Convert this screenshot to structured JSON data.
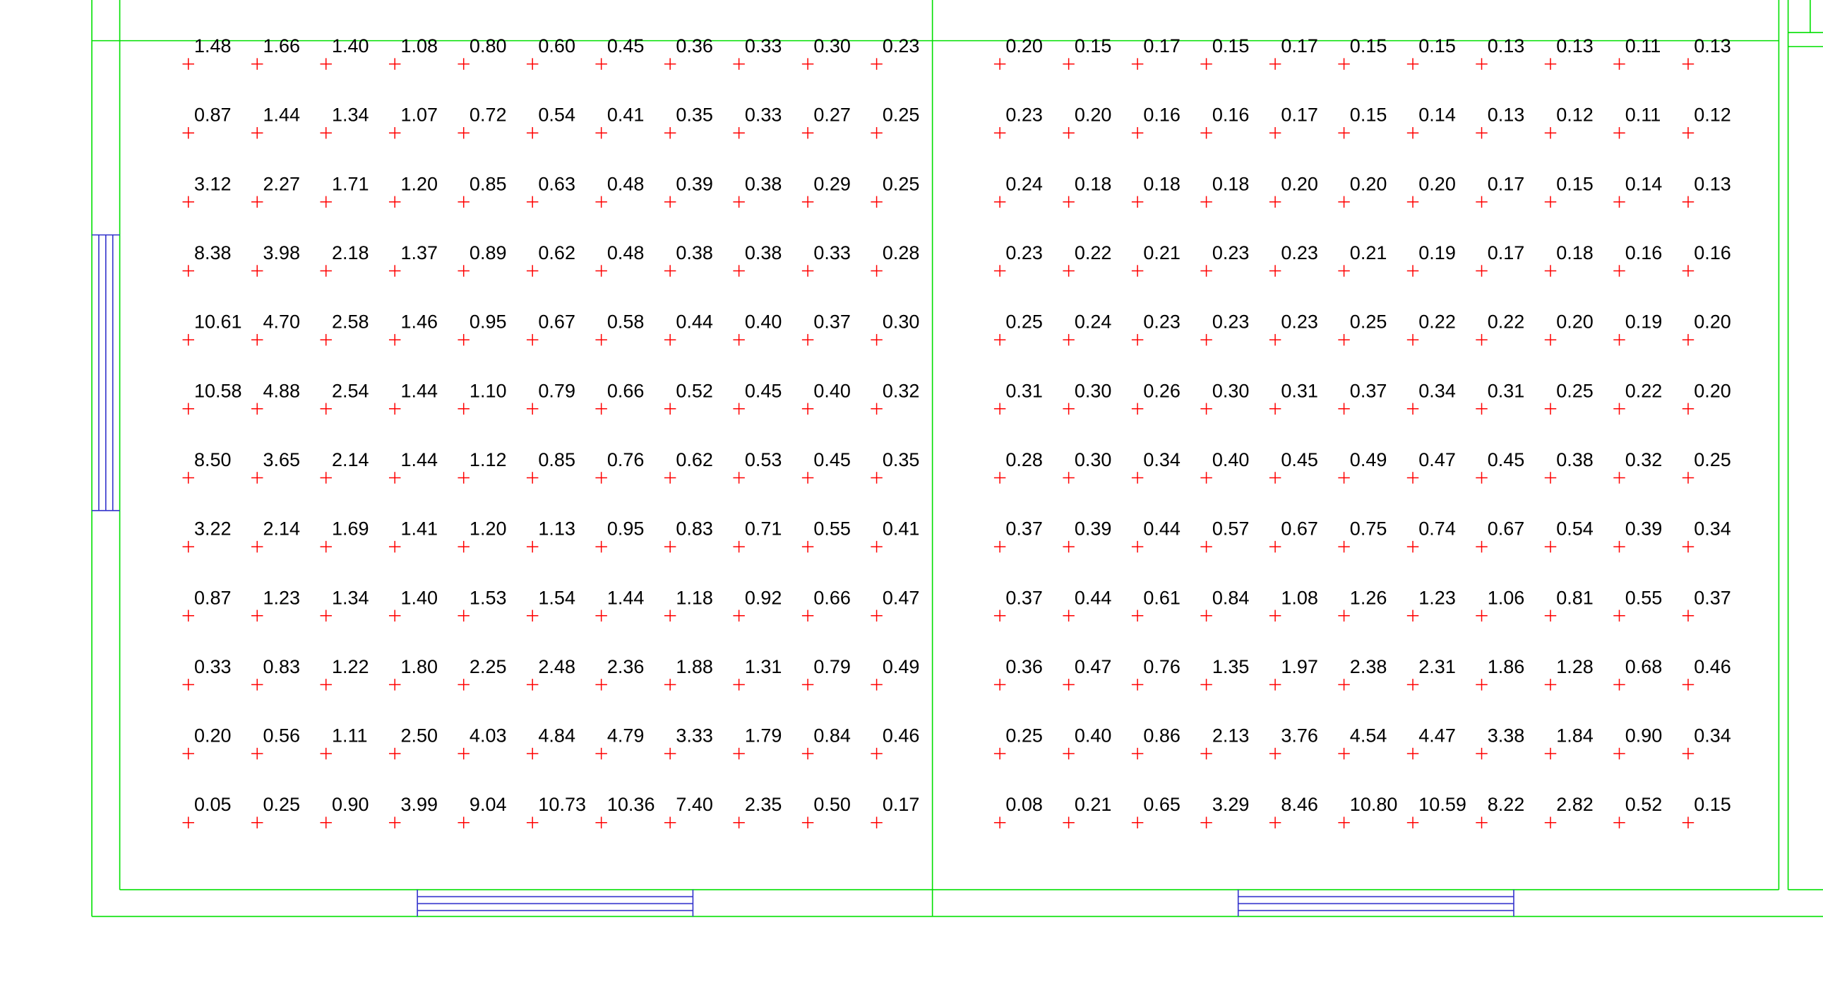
{
  "colors": {
    "background": "#ffffff",
    "walls": "#00e000",
    "windows": "#3333cc",
    "points": "#ff0000",
    "values": "#000000"
  },
  "icons": {
    "measurement_point": "red-plus-cross-icon",
    "window": "parallel-lines-window-symbol"
  },
  "rooms": [
    {
      "name": "left-room",
      "grid": [
        [
          "1.48",
          "1.66",
          "1.40",
          "1.08",
          "0.80",
          "0.60",
          "0.45",
          "0.36",
          "0.33",
          "0.30",
          "0.23"
        ],
        [
          "0.87",
          "1.44",
          "1.34",
          "1.07",
          "0.72",
          "0.54",
          "0.41",
          "0.35",
          "0.33",
          "0.27",
          "0.25"
        ],
        [
          "3.12",
          "2.27",
          "1.71",
          "1.20",
          "0.85",
          "0.63",
          "0.48",
          "0.39",
          "0.38",
          "0.29",
          "0.25"
        ],
        [
          "8.38",
          "3.98",
          "2.18",
          "1.37",
          "0.89",
          "0.62",
          "0.48",
          "0.38",
          "0.38",
          "0.33",
          "0.28"
        ],
        [
          "10.61",
          "4.70",
          "2.58",
          "1.46",
          "0.95",
          "0.67",
          "0.58",
          "0.44",
          "0.40",
          "0.37",
          "0.30"
        ],
        [
          "10.58",
          "4.88",
          "2.54",
          "1.44",
          "1.10",
          "0.79",
          "0.66",
          "0.52",
          "0.45",
          "0.40",
          "0.32"
        ],
        [
          "8.50",
          "3.65",
          "2.14",
          "1.44",
          "1.12",
          "0.85",
          "0.76",
          "0.62",
          "0.53",
          "0.45",
          "0.35"
        ],
        [
          "3.22",
          "2.14",
          "1.69",
          "1.41",
          "1.20",
          "1.13",
          "0.95",
          "0.83",
          "0.71",
          "0.55",
          "0.41"
        ],
        [
          "0.87",
          "1.23",
          "1.34",
          "1.40",
          "1.53",
          "1.54",
          "1.44",
          "1.18",
          "0.92",
          "0.66",
          "0.47"
        ],
        [
          "0.33",
          "0.83",
          "1.22",
          "1.80",
          "2.25",
          "2.48",
          "2.36",
          "1.88",
          "1.31",
          "0.79",
          "0.49"
        ],
        [
          "0.20",
          "0.56",
          "1.11",
          "2.50",
          "4.03",
          "4.84",
          "4.79",
          "3.33",
          "1.79",
          "0.84",
          "0.46"
        ],
        [
          "0.05",
          "0.25",
          "0.90",
          "3.99",
          "9.04",
          "10.73",
          "10.36",
          "7.40",
          "2.35",
          "0.50",
          "0.17"
        ]
      ]
    },
    {
      "name": "right-room",
      "grid": [
        [
          "0.20",
          "0.15",
          "0.17",
          "0.15",
          "0.17",
          "0.15",
          "0.15",
          "0.13",
          "0.13",
          "0.11",
          "0.13"
        ],
        [
          "0.23",
          "0.20",
          "0.16",
          "0.16",
          "0.17",
          "0.15",
          "0.14",
          "0.13",
          "0.12",
          "0.11",
          "0.12"
        ],
        [
          "0.24",
          "0.18",
          "0.18",
          "0.18",
          "0.20",
          "0.20",
          "0.20",
          "0.17",
          "0.15",
          "0.14",
          "0.13"
        ],
        [
          "0.23",
          "0.22",
          "0.21",
          "0.23",
          "0.23",
          "0.21",
          "0.19",
          "0.17",
          "0.18",
          "0.16",
          "0.16"
        ],
        [
          "0.25",
          "0.24",
          "0.23",
          "0.23",
          "0.23",
          "0.25",
          "0.22",
          "0.22",
          "0.20",
          "0.19",
          "0.20"
        ],
        [
          "0.31",
          "0.30",
          "0.26",
          "0.30",
          "0.31",
          "0.37",
          "0.34",
          "0.31",
          "0.25",
          "0.22",
          "0.20"
        ],
        [
          "0.28",
          "0.30",
          "0.34",
          "0.40",
          "0.45",
          "0.49",
          "0.47",
          "0.45",
          "0.38",
          "0.32",
          "0.25"
        ],
        [
          "0.37",
          "0.39",
          "0.44",
          "0.57",
          "0.67",
          "0.75",
          "0.74",
          "0.67",
          "0.54",
          "0.39",
          "0.34"
        ],
        [
          "0.37",
          "0.44",
          "0.61",
          "0.84",
          "1.08",
          "1.26",
          "1.23",
          "1.06",
          "0.81",
          "0.55",
          "0.37"
        ],
        [
          "0.36",
          "0.47",
          "0.76",
          "1.35",
          "1.97",
          "2.38",
          "2.31",
          "1.86",
          "1.28",
          "0.68",
          "0.46"
        ],
        [
          "0.25",
          "0.40",
          "0.86",
          "2.13",
          "3.76",
          "4.54",
          "4.47",
          "3.38",
          "1.84",
          "0.90",
          "0.34"
        ],
        [
          "0.08",
          "0.21",
          "0.65",
          "3.29",
          "8.46",
          "10.80",
          "10.59",
          "8.22",
          "2.82",
          "0.52",
          "0.15"
        ]
      ]
    }
  ]
}
